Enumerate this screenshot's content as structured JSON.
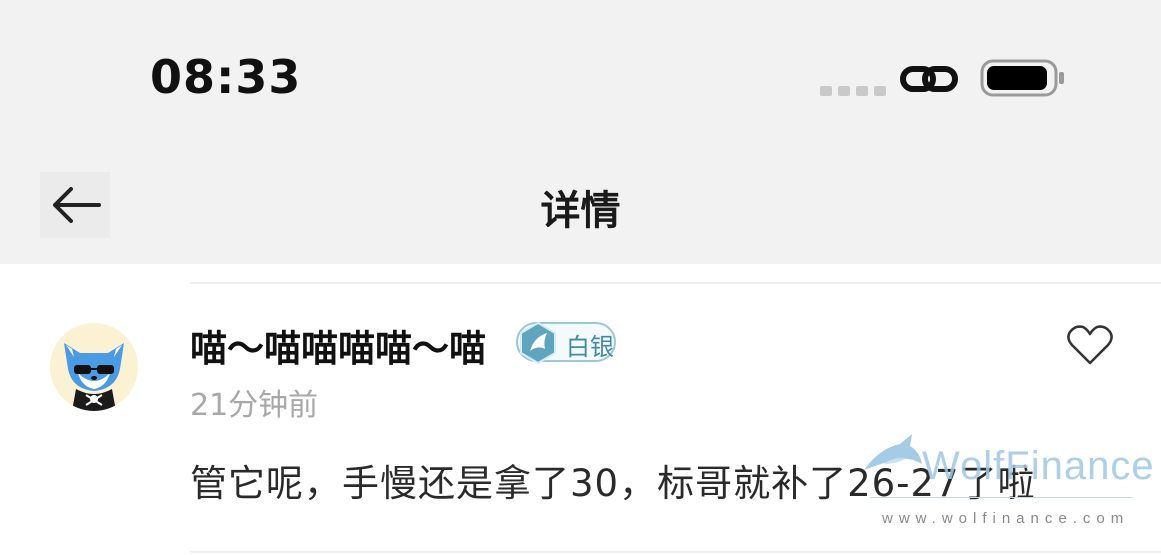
{
  "status_bar": {
    "time": "08:33",
    "link_icon": "link-icon",
    "battery_icon": "battery-icon"
  },
  "nav": {
    "back_icon": "arrow-left-icon",
    "title": "详情"
  },
  "comment": {
    "username": "喵～喵喵喵喵～喵",
    "badge_label": "白银",
    "badge_icon": "silver-rank-icon",
    "timestamp": "21分钟前",
    "text": "管它呢，手慢还是拿了30，标哥就补了26-27了啦",
    "like_icon": "heart-outline-icon"
  },
  "watermark": {
    "brand": "WolfFinance",
    "url": "www.wolfinance.com"
  },
  "colors": {
    "bar_bg": "#f2f2f2",
    "badge_accent": "#3f8aa6",
    "timestamp": "#a8a8a8"
  }
}
